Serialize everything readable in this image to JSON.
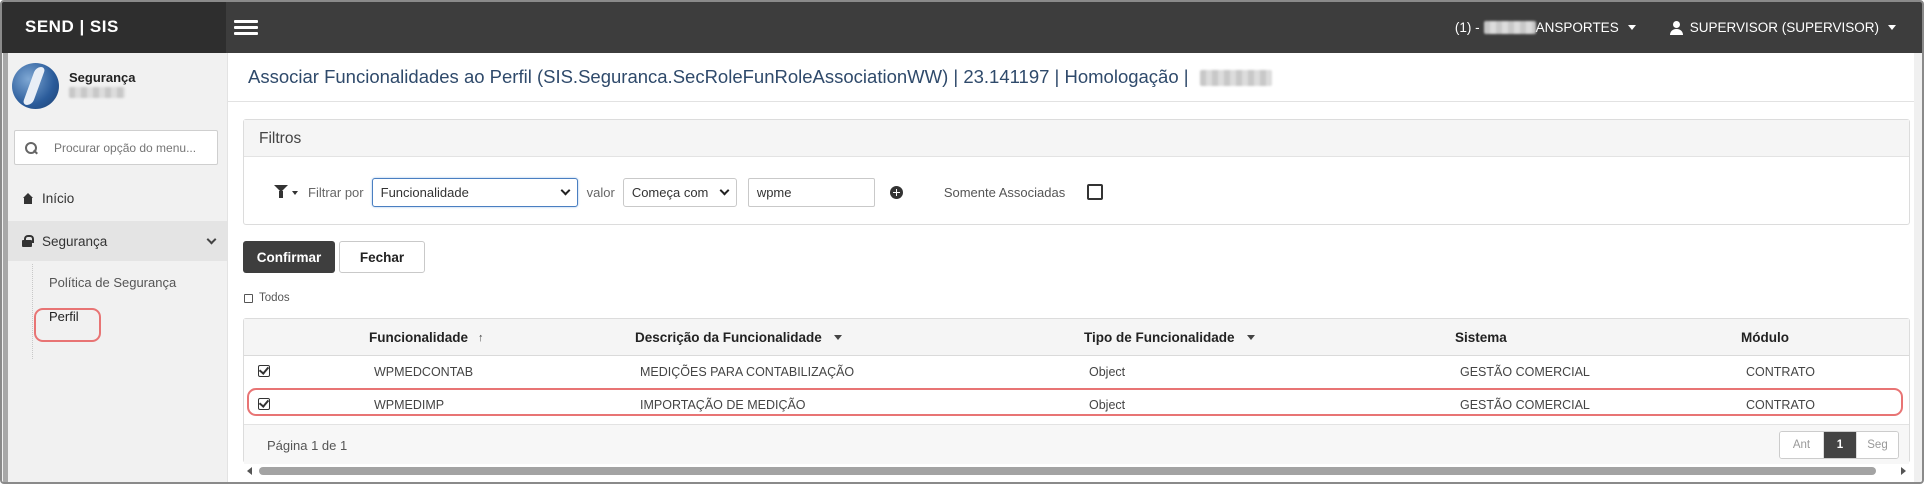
{
  "app": {
    "brand": "SEND | SIS"
  },
  "topbar": {
    "company_prefix": "(1) -",
    "company_suffix": "ANSPORTES",
    "user": "SUPERVISOR (SUPERVISOR)"
  },
  "sidebar": {
    "module_name": "Segurança",
    "search_placeholder": "Procurar opção do menu...",
    "items": [
      {
        "label": "Início",
        "icon": "home-icon"
      },
      {
        "label": "Segurança",
        "icon": "lock-icon",
        "expanded": true
      }
    ],
    "subitems": [
      {
        "label": "Política de Segurança"
      },
      {
        "label": "Perfil",
        "active": true
      }
    ]
  },
  "page": {
    "title": "Associar Funcionalidades ao Perfil (SIS.Seguranca.SecRoleFunRoleAssociationWW) | 23.141197 | Homologação |"
  },
  "filters": {
    "header": "Filtros",
    "filter_by_label": "Filtrar por",
    "filter_by_value": "Funcionalidade",
    "value_label": "valor",
    "operator_value": "Começa com",
    "text_value": "wpme",
    "only_associated_label": "Somente Associadas",
    "only_associated_checked": false
  },
  "actions": {
    "confirm_label": "Confirmar",
    "close_label": "Fechar",
    "select_all_label": "Todos"
  },
  "grid": {
    "columns": [
      {
        "label": "Funcionalidade",
        "sort": "asc"
      },
      {
        "label": "Descrição da Funcionalidade",
        "sort": "menu"
      },
      {
        "label": "Tipo de Funcionalidade",
        "sort": "menu"
      },
      {
        "label": "Sistema"
      },
      {
        "label": "Módulo"
      }
    ],
    "rows": [
      {
        "checked": true,
        "funcionalidade": "WPMEDCONTAB",
        "descricao": "MEDIÇÕES PARA CONTABILIZAÇÃO",
        "tipo": "Object",
        "sistema": "GESTÃO COMERCIAL",
        "modulo": "CONTRATO"
      },
      {
        "checked": true,
        "funcionalidade": "WPMEDIMP",
        "descricao": "IMPORTAÇÃO DE MEDIÇÃO",
        "tipo": "Object",
        "sistema": "GESTÃO COMERCIAL",
        "modulo": "CONTRATO"
      }
    ],
    "page_info": "Página 1 de 1",
    "pager": {
      "prev": "Ant",
      "current": "1",
      "next": "Seg"
    }
  },
  "colors": {
    "topbar": "#3d3d3d",
    "brand_bg": "#2e2e2e",
    "title": "#2f4a6b",
    "highlight": "#e87474",
    "primary_button": "#3e3e3e"
  }
}
